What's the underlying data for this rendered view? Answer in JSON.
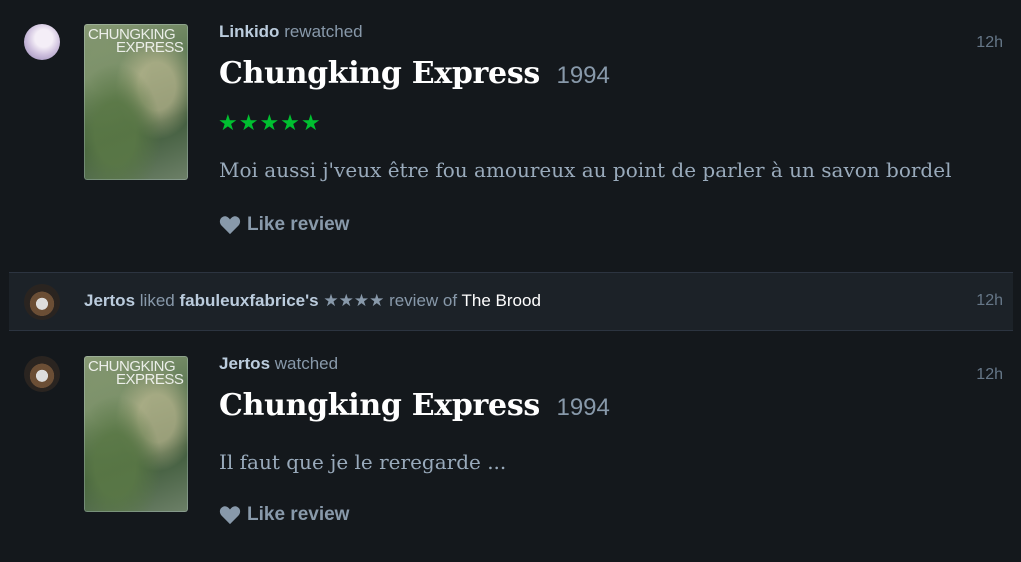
{
  "feed": [
    {
      "user": "Linkido",
      "action": "rewatched",
      "time": "12h",
      "film_title": "Chungking Express",
      "film_year": "1994",
      "rating_stars": "★★★★★",
      "review_text": "Moi aussi j'veux être fou amoureux au point de parler à un savon bordel",
      "like_label": "Like review",
      "poster_title_line1": "CHUNGKING",
      "poster_title_line2": "EXPRESS"
    },
    {
      "user": "Jertos",
      "action": "liked",
      "target_user": "fabuleuxfabrice's",
      "rating_stars": "★★★★",
      "review_of_label": "review of",
      "film_title": "The Brood",
      "time": "12h"
    },
    {
      "user": "Jertos",
      "action": "watched",
      "time": "12h",
      "film_title": "Chungking Express",
      "film_year": "1994",
      "review_text": "Il faut que je le reregarde ...",
      "like_label": "Like review",
      "poster_title_line1": "CHUNGKING",
      "poster_title_line2": "EXPRESS"
    }
  ],
  "colors": {
    "background": "#14181c",
    "star_green": "#00c030",
    "muted": "#8899aa"
  },
  "icons": [
    "heart-icon",
    "avatar"
  ]
}
